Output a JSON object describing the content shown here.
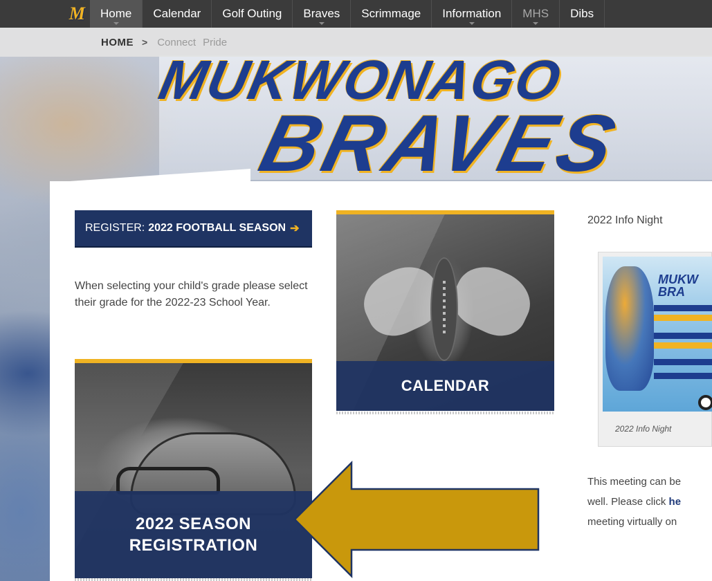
{
  "nav": {
    "logo": "M",
    "items": [
      {
        "label": "Home",
        "active": true,
        "caret": true
      },
      {
        "label": "Calendar",
        "active": false,
        "caret": false
      },
      {
        "label": "Golf Outing",
        "active": false,
        "caret": false
      },
      {
        "label": "Braves",
        "active": false,
        "caret": true
      },
      {
        "label": "Scrimmage",
        "active": false,
        "caret": false
      },
      {
        "label": "Information",
        "active": false,
        "caret": true
      },
      {
        "label": "MHS",
        "active": false,
        "caret": true,
        "dim": true
      },
      {
        "label": "Dibs",
        "active": false,
        "caret": false
      }
    ]
  },
  "breadcrumb": {
    "home": "HOME",
    "separator": ">",
    "items": [
      "Connect",
      "Pride"
    ]
  },
  "banner": {
    "line1": "MUKWONAGO",
    "line2": "BRAVES"
  },
  "register": {
    "prefix": "REGISTER:",
    "bold": "2022 FOOTBALL SEASON",
    "arrow": "➔"
  },
  "grade_note": "When selecting your child's grade please select their grade for the 2022-23 School Year.",
  "tiles": {
    "calendar": "CALENDAR",
    "registration_line1": "2022 SEASON",
    "registration_line2": "REGISTRATION"
  },
  "info": {
    "heading": "2022 Info Night",
    "poster_title_1": "MUKW",
    "poster_title_2": "BRA",
    "caption": "2022 Info Night",
    "meeting_line1": "This meeting can be",
    "meeting_line2_pre": "well.   Please click ",
    "meeting_line2_link": "he",
    "meeting_line3": "meeting virtually on"
  },
  "colors": {
    "navy": "#1f3463",
    "gold": "#f0b323",
    "annotation_arrow": "#c9980c"
  }
}
